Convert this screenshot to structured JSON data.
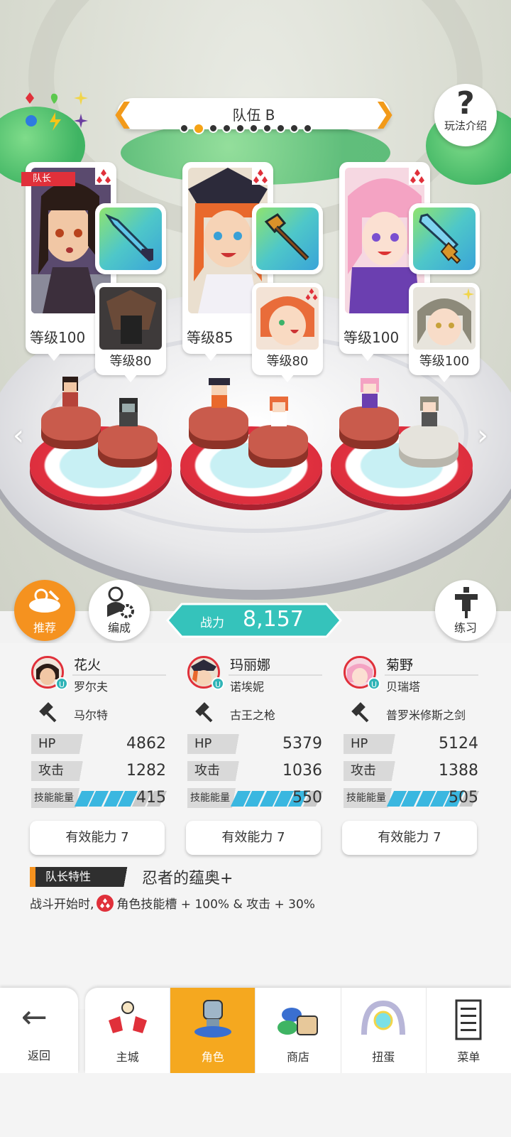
{
  "header": {
    "team_title": "队伍 B",
    "help_label": "玩法介绍",
    "page_dots": {
      "count": 10,
      "active_index": 1
    }
  },
  "cards": [
    {
      "leader_tag": "队长",
      "level": "等级100",
      "sub_level": "等级80"
    },
    {
      "leader_tag": "",
      "level": "等级85",
      "sub_level": "等级80"
    },
    {
      "leader_tag": "",
      "level": "等级100",
      "sub_level": "等级100"
    }
  ],
  "actions": {
    "recommend_label": "推荐",
    "formation_label": "编成",
    "practice_label": "练习",
    "power_label": "战力",
    "power_value": "8,157"
  },
  "members": [
    {
      "name": "花火",
      "class": "罗尔夫",
      "weapon": "马尔特",
      "hp_label": "HP",
      "hp": "4862",
      "atk_label": "攻击",
      "atk": "1282",
      "skill_label": "技能能量",
      "skill": "415",
      "skill_fill": 0.72,
      "effective": "有效能力 7"
    },
    {
      "name": "玛丽娜",
      "class": "诺埃妮",
      "weapon": "古王之枪",
      "hp_label": "HP",
      "hp": "5379",
      "atk_label": "攻击",
      "atk": "1036",
      "skill_label": "技能能量",
      "skill": "550",
      "skill_fill": 0.82,
      "effective": "有效能力 7"
    },
    {
      "name": "菊野",
      "class": "贝瑞塔",
      "weapon": "普罗米修斯之剑",
      "hp_label": "HP",
      "hp": "5124",
      "atk_label": "攻击",
      "atk": "1388",
      "skill_label": "技能能量",
      "skill": "505",
      "skill_fill": 0.78,
      "effective": "有效能力 7"
    }
  ],
  "leader_trait": {
    "label": "队长特性",
    "name": "忍者的蕴奥+",
    "desc_prefix": "战斗开始时,",
    "desc_suffix": "角色技能槽 + 100% & 攻击 + 30%"
  },
  "nav": {
    "back_label": "返回",
    "tabs": [
      {
        "label": "主城",
        "icon": "castle-icon"
      },
      {
        "label": "角色",
        "icon": "character-icon"
      },
      {
        "label": "商店",
        "icon": "shop-icon"
      },
      {
        "label": "扭蛋",
        "icon": "gacha-icon"
      },
      {
        "label": "菜单",
        "icon": "menu-icon"
      }
    ],
    "active_tab": 1
  },
  "colors": {
    "accent_orange": "#f5921f",
    "leader_red": "#e0303a",
    "power_teal": "#35c3bb",
    "skill_blue": "#3ab7e0"
  }
}
